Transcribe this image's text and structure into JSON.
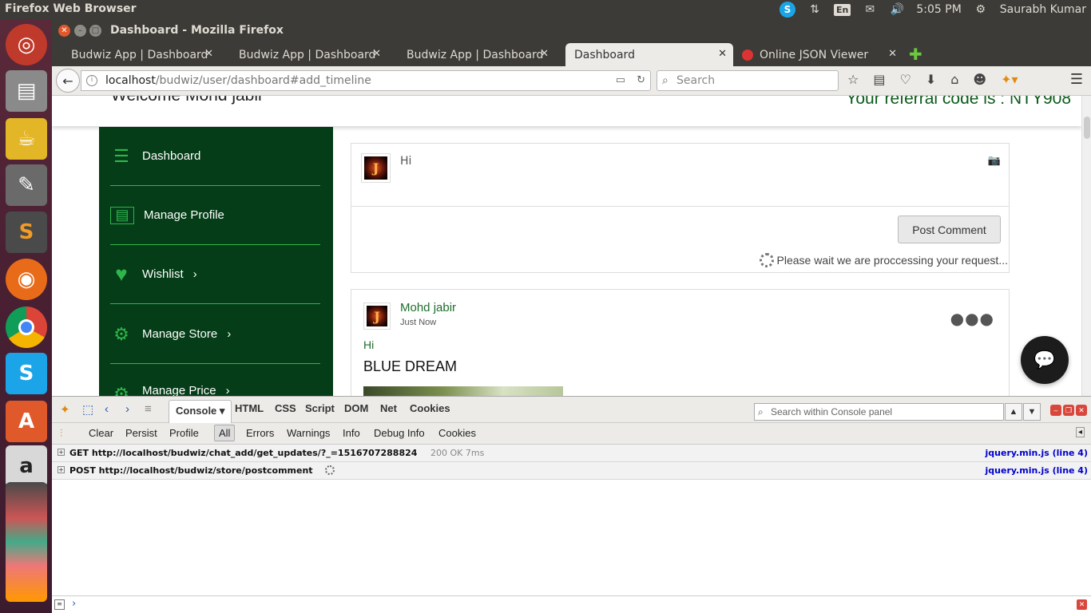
{
  "topbar": {
    "app_title": "Firefox Web Browser",
    "keyboard_layout": "En",
    "time": "5:05 PM",
    "user": "Saurabh Kumar"
  },
  "launcher": {
    "items": [
      {
        "icon": "ubuntu-logo-icon",
        "color": "#c03a2b"
      },
      {
        "icon": "files-icon",
        "color": "#8a8a8a"
      },
      {
        "icon": "teapot-icon",
        "color": "#e3b628"
      },
      {
        "icon": "text-editor-icon",
        "color": "#6a6a6a"
      },
      {
        "icon": "sublime-text-icon",
        "color": "#4a4a4a"
      },
      {
        "icon": "firefox-icon",
        "color": "#e86b1a"
      },
      {
        "icon": "chrome-icon",
        "color": "#3b8fd8"
      },
      {
        "icon": "skype-icon",
        "color": "#1ba5e8"
      },
      {
        "icon": "software-center-icon",
        "color": "#e0592a"
      },
      {
        "icon": "amazon-icon",
        "color": "#d8d8d8"
      }
    ]
  },
  "window": {
    "title": "Dashboard - Mozilla Firefox"
  },
  "tabs": [
    {
      "label": "Budwiz App | Dashboard"
    },
    {
      "label": "Budwiz App | Dashboard"
    },
    {
      "label": "Budwiz App | Dashboard"
    },
    {
      "label": "Dashboard"
    },
    {
      "label": "Online JSON Viewer"
    }
  ],
  "urlbar": {
    "host": "localhost",
    "path": "/budwiz/user/dashboard#add_timeline"
  },
  "searchbar": {
    "placeholder": "Search"
  },
  "page": {
    "welcome": "Welcome Mohd jabir",
    "referral": "Your referral code is : NTY908",
    "sidebar": [
      {
        "label": "Dashboard",
        "icon": "list-icon"
      },
      {
        "label": "Manage Profile",
        "icon": "id-card-icon"
      },
      {
        "label": "Wishlist",
        "icon": "heart-icon"
      },
      {
        "label": "Manage Store",
        "icon": "gear-icon"
      },
      {
        "label": "Manage Price",
        "icon": "gear-icon"
      }
    ],
    "comment_box": {
      "text": "Hi",
      "post_button": "Post Comment",
      "wait_message": "Please wait we are proccessing your request..."
    },
    "post": {
      "author": "Mohd jabir",
      "time": "Just Now",
      "text": "Hi",
      "title": "BLUE DREAM"
    },
    "avatar_letter": "J"
  },
  "firebug": {
    "tabs": [
      "Console",
      "HTML",
      "CSS",
      "Script",
      "DOM",
      "Net",
      "Cookies"
    ],
    "search_placeholder": "Search within Console panel",
    "filters": [
      "Clear",
      "Persist",
      "Profile",
      "All",
      "Errors",
      "Warnings",
      "Info",
      "Debug Info",
      "Cookies"
    ],
    "logs": [
      {
        "method_url": "GET http://localhost/budwiz/chat_add/get_updates/?_=1516707288824",
        "status": "200 OK 7ms",
        "source": "jquery.min.js (line 4)"
      },
      {
        "method_url": "POST http://localhost/budwiz/store/postcomment",
        "status": "",
        "source": "jquery.min.js (line 4)"
      }
    ],
    "prompt": "›"
  }
}
